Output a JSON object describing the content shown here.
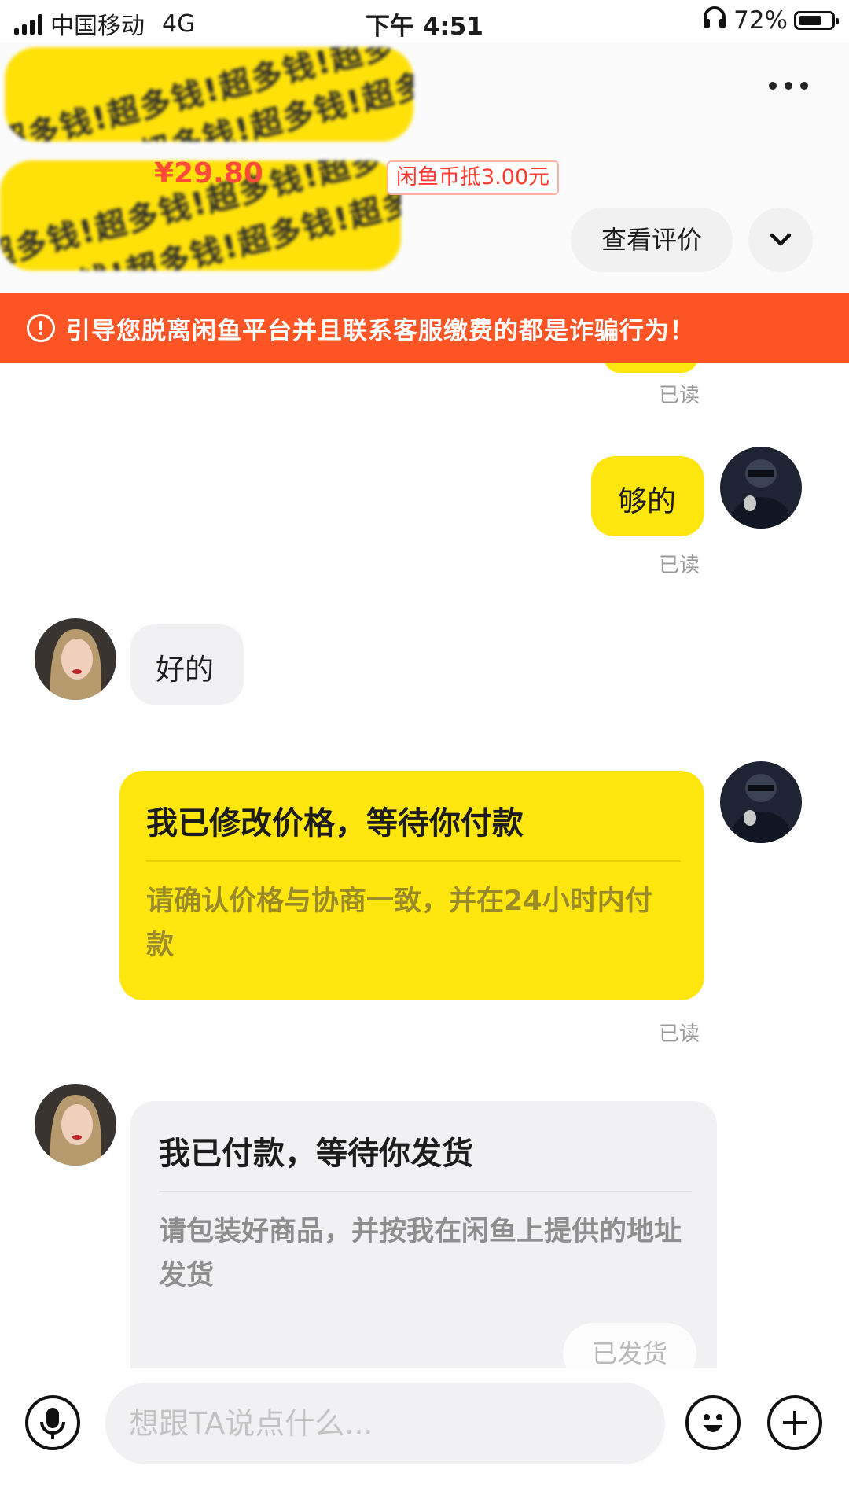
{
  "status_bar": {
    "carrier": "中国移动",
    "network": "4G",
    "time": "下午 4:51",
    "battery_pct": "72%",
    "battery_level": 0.72
  },
  "header": {
    "censor_text": "超多钱!超多钱!超多钱!超多钱!",
    "price": "¥29.80",
    "coin_tag": "闲鱼币抵3.00元",
    "review_button": "查看评价",
    "more_icon": "more-icon",
    "expand_icon": "chevron-down-icon"
  },
  "warning": {
    "text": "引导您脱离闲鱼平台并且联系客服缴费的都是诈骗行为！",
    "icon": "alert-circle-icon"
  },
  "chat": {
    "read_label": "已读",
    "messages": [
      {
        "from": "me",
        "text": "够的"
      },
      {
        "from": "other",
        "text": "好的"
      },
      {
        "from": "me",
        "card_title": "我已修改价格，等待你付款",
        "card_sub": "请确认价格与协商一致，并在24小时内付款"
      },
      {
        "from": "other",
        "card_title": "我已付款，等待你发货",
        "card_sub": "请包装好商品，并按我在闲鱼上提供的地址发货",
        "action": "已发货"
      }
    ]
  },
  "input_bar": {
    "placeholder": "想跟TA说点什么...",
    "mic_icon": "microphone-icon",
    "emoji_icon": "emoji-icon",
    "plus_icon": "plus-icon"
  },
  "colors": {
    "accent_yellow": "#ffe60f",
    "warning_orange": "#fc5424",
    "price_red": "#ff4b3a"
  }
}
